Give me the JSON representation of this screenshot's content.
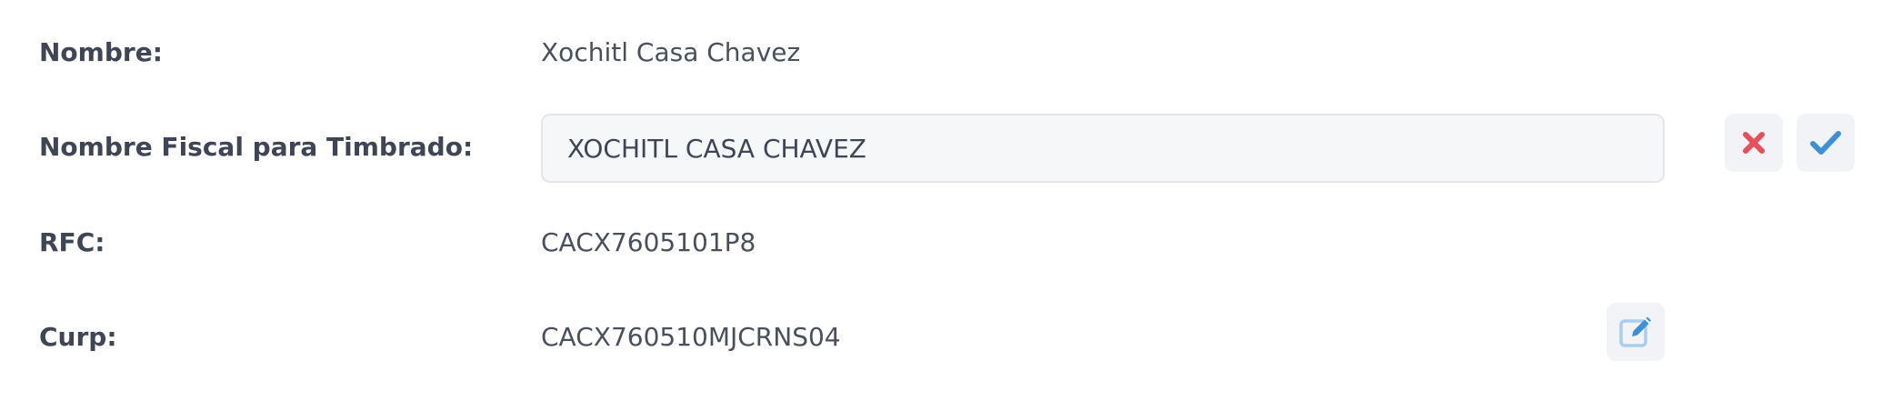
{
  "fields": {
    "nombre": {
      "label": "Nombre:",
      "value": "Xochitl Casa Chavez"
    },
    "nombre_fiscal": {
      "label": "Nombre Fiscal para Timbrado:",
      "value": "XOCHITL CASA CHAVEZ"
    },
    "rfc": {
      "label": "RFC:",
      "value": "CACX7605101P8"
    },
    "curp": {
      "label": "Curp:",
      "value": "CACX760510MJCRNS04"
    }
  },
  "icons": {
    "cancel": "x-icon",
    "confirm": "check-icon",
    "edit": "edit-icon"
  },
  "colors": {
    "cancel": "#e5505a",
    "confirm": "#3d8fd6",
    "edit": "#3d8fd6"
  }
}
